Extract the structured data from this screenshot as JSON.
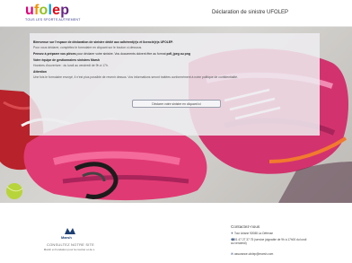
{
  "header": {
    "logo": {
      "word": [
        "u",
        "f",
        "o",
        "l",
        "e",
        "p"
      ],
      "tagline": "TOUS LES SPORTS AUTREMENT"
    },
    "title": "Déclaration de sinistre UFOLEP"
  },
  "card": {
    "welcome": "Bienvenue sur l'espace de déclaration de sinistre dédié aux adhérent(e)s et licencié(e)s UFOLEP.",
    "intro": "Pour vous déclarer, complétez le formulaire en cliquant sur le bouton ci-dessous.",
    "prepare_label": "Pensez à préparer vos pièces",
    "prepare_rest": " pour déclarer votre sinistre. Vos documents doivent être au format",
    "formats": "pdf, jpeg ou png",
    "team_title": "Votre équipe de gestionnaires sinistres Marsh",
    "hours": "Horaires d'ouverture : du lundi au vendredi de 9h à 17h.",
    "attention": "Attention",
    "attention_text": "Une fois le formulaire envoyé, il n'est plus possible de revenir dessus. Vos informations seront traitées conformément à notre politique de confidentialité.",
    "button": "Déclarer votre sinistre en cliquant ici"
  },
  "footer": {
    "brand": "Marsh",
    "site_link": "CONSULTEZ NOTRE SITE",
    "site_desc": "Marsh et Fondation pour la courtier et de s",
    "contact_title": "Contactez-nous",
    "address": "Tour Ariane 92088 La Défense",
    "phone": "01 47 27 37 75 (service joignable de 9h à 17h00 du lundi au vendredi)",
    "email": "assurance.ufolep@marsh.com",
    "icons": [
      "map-pin-icon",
      "phone-icon",
      "mail-icon"
    ]
  },
  "colors": {
    "ufolep_pink": "#e2007a",
    "ufolep_orange": "#f39200",
    "ufolep_green": "#95c11f",
    "ufolep_blue": "#009fe3",
    "marsh_navy": "#1d3f73"
  }
}
